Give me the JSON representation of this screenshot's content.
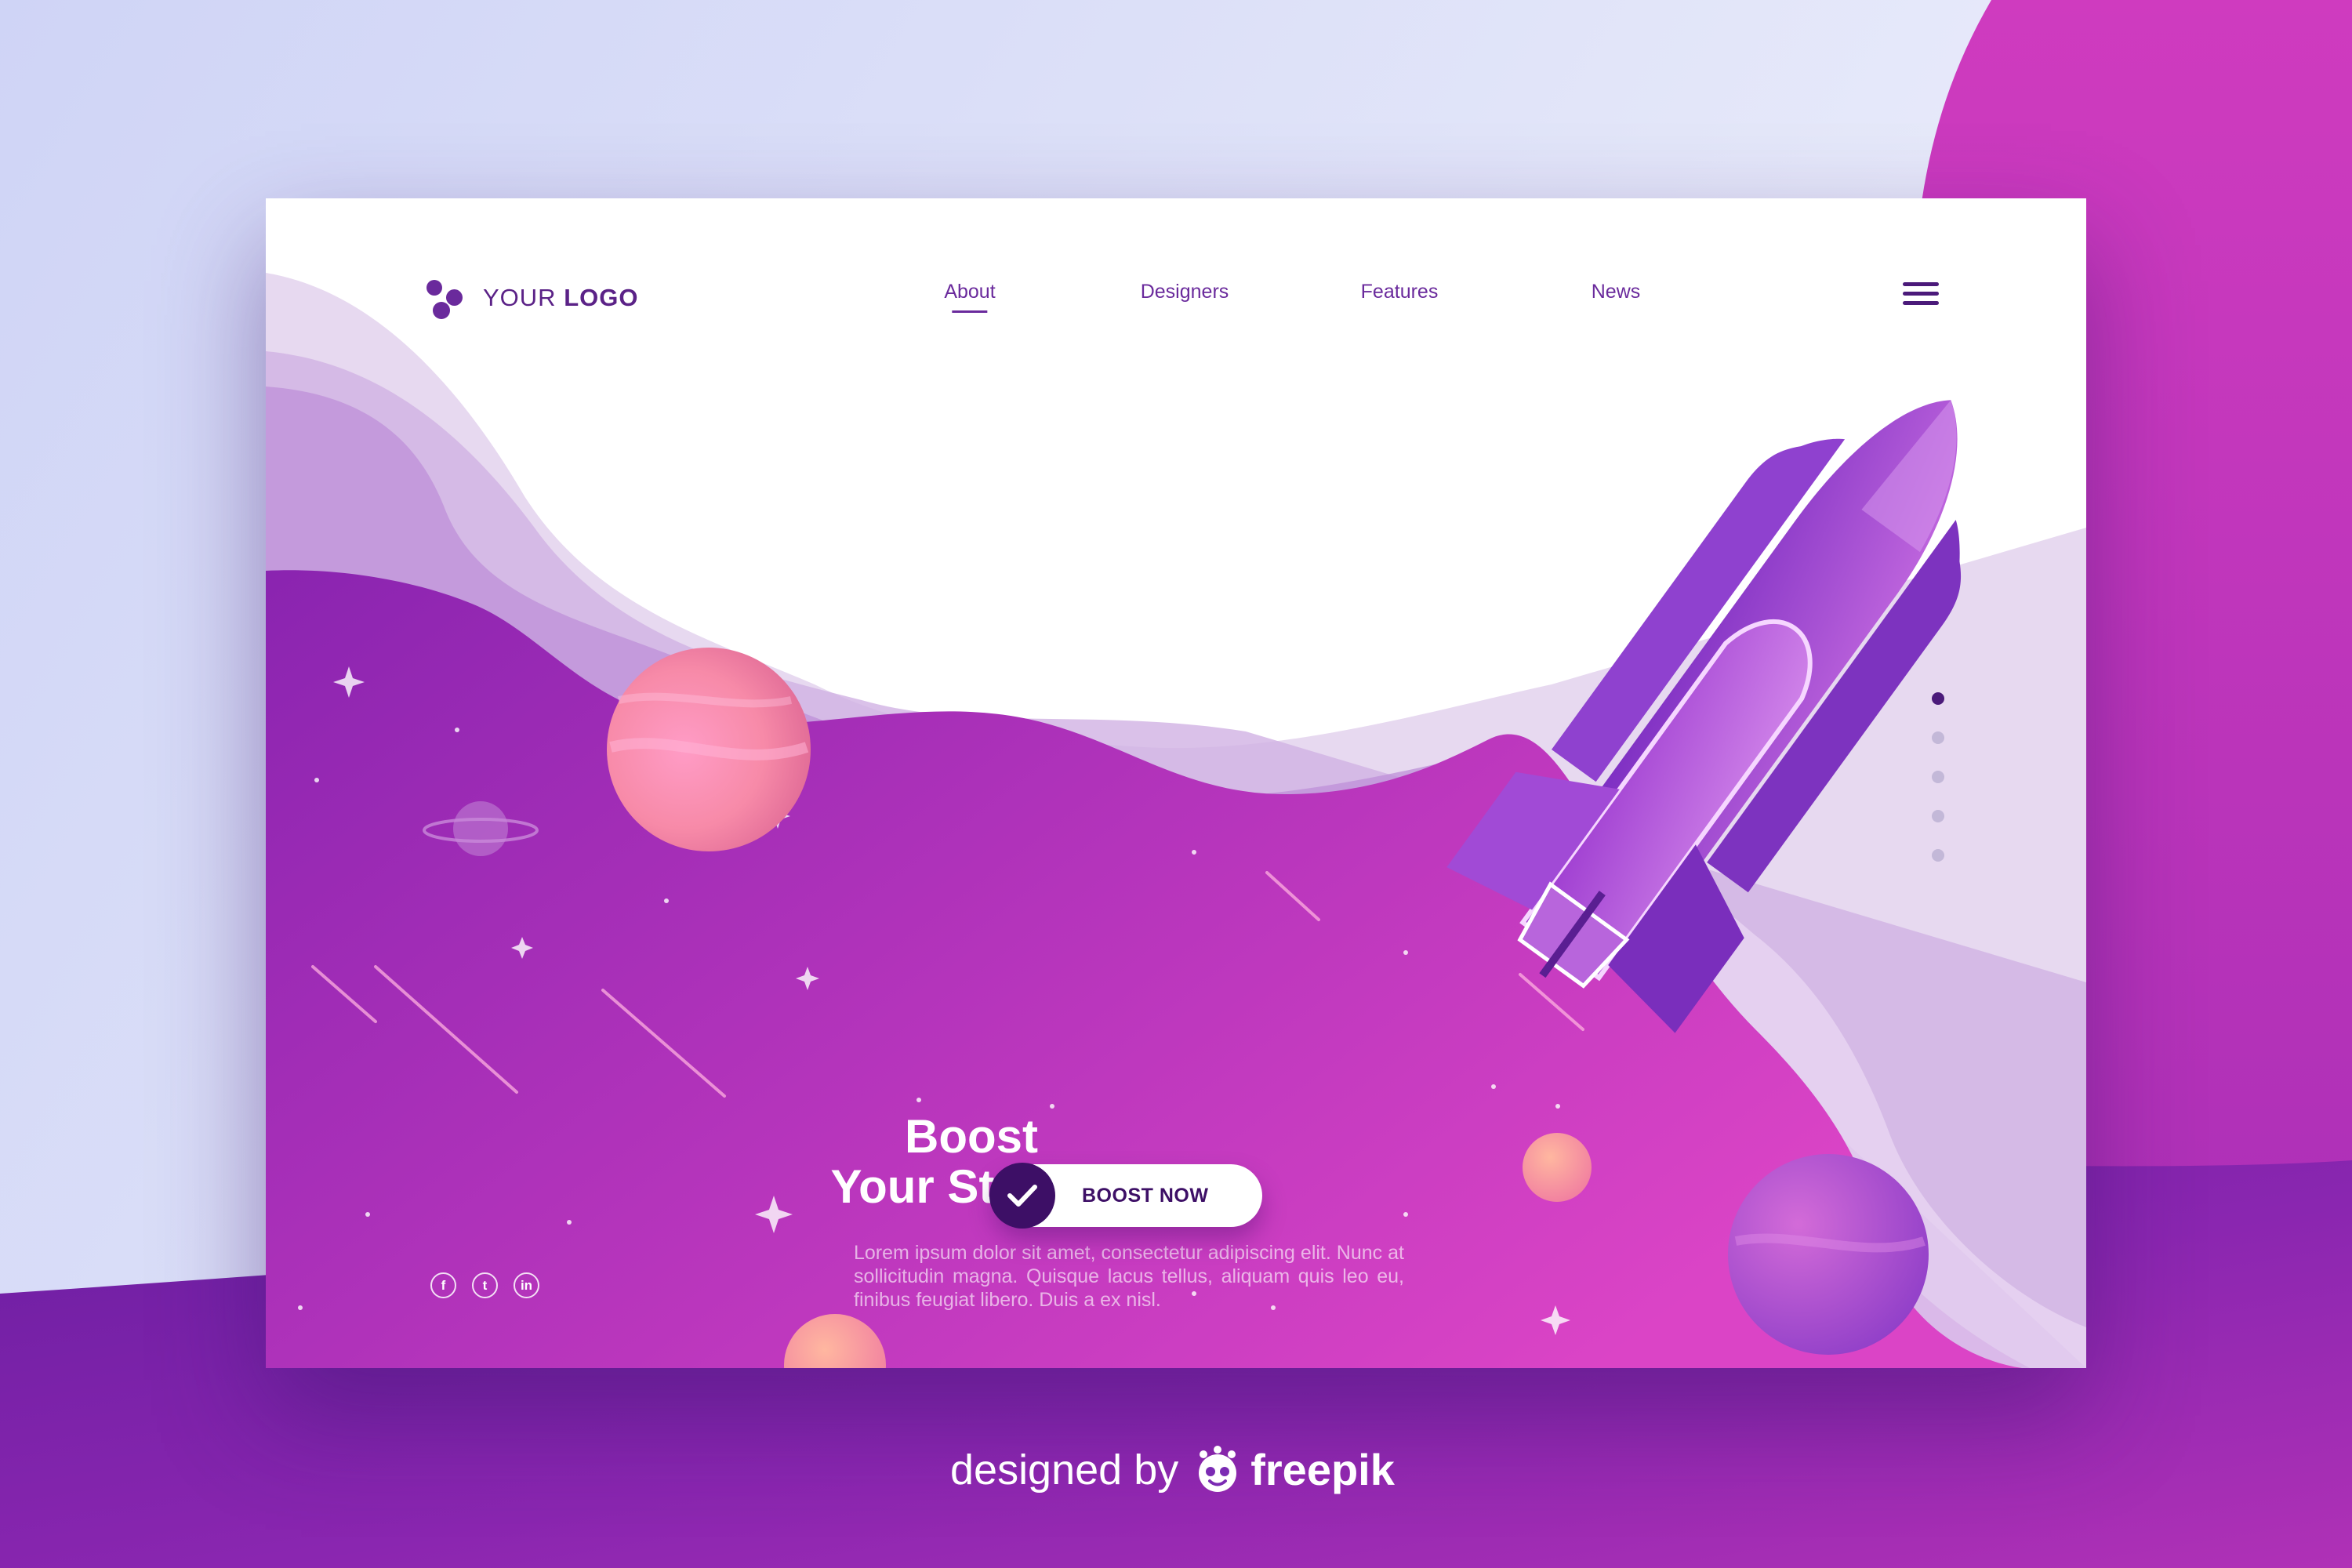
{
  "colors": {
    "accent_dark": "#3d0f66",
    "accent": "#6a2a9c",
    "magenta": "#c43bbf",
    "purple": "#7b2bb3",
    "planet_pink": "#ff8fb0",
    "white": "#ffffff"
  },
  "logo": {
    "icon": "three-dots-logo-icon",
    "text_regular": "YOUR ",
    "text_bold": "LOGO"
  },
  "nav": {
    "items": [
      {
        "label": "About",
        "active": true
      },
      {
        "label": "Designers",
        "active": false
      },
      {
        "label": "Features",
        "active": false
      },
      {
        "label": "News",
        "active": false
      }
    ],
    "menu_icon": "hamburger-menu-icon"
  },
  "slider": {
    "count": 5,
    "active_index": 0
  },
  "hero": {
    "title_line1": "Boost",
    "title_line2": "Your Startup",
    "body": "Lorem ipsum dolor sit amet, consectetur adipiscing elit. Nunc at sollicitudin magna. Quisque lacus tellus, aliquam quis leo eu, finibus feugiat libero. Duis a ex nisl.",
    "cta_label": "BOOST NOW",
    "cta_icon": "checkmark-icon"
  },
  "social": {
    "items": [
      {
        "name": "facebook-icon",
        "glyph": "f"
      },
      {
        "name": "twitter-icon",
        "glyph": "t"
      },
      {
        "name": "linkedin-icon",
        "glyph": "in"
      }
    ]
  },
  "credit": {
    "text": "designed by",
    "brand": "freepik",
    "brand_icon": "freepik-mascot-icon"
  },
  "illustration": {
    "rocket": "rocket-illustration",
    "planets": [
      "planet-large-pink",
      "planet-ringed",
      "planet-small-orange",
      "planet-large-violet",
      "planet-bottom-peach"
    ]
  }
}
